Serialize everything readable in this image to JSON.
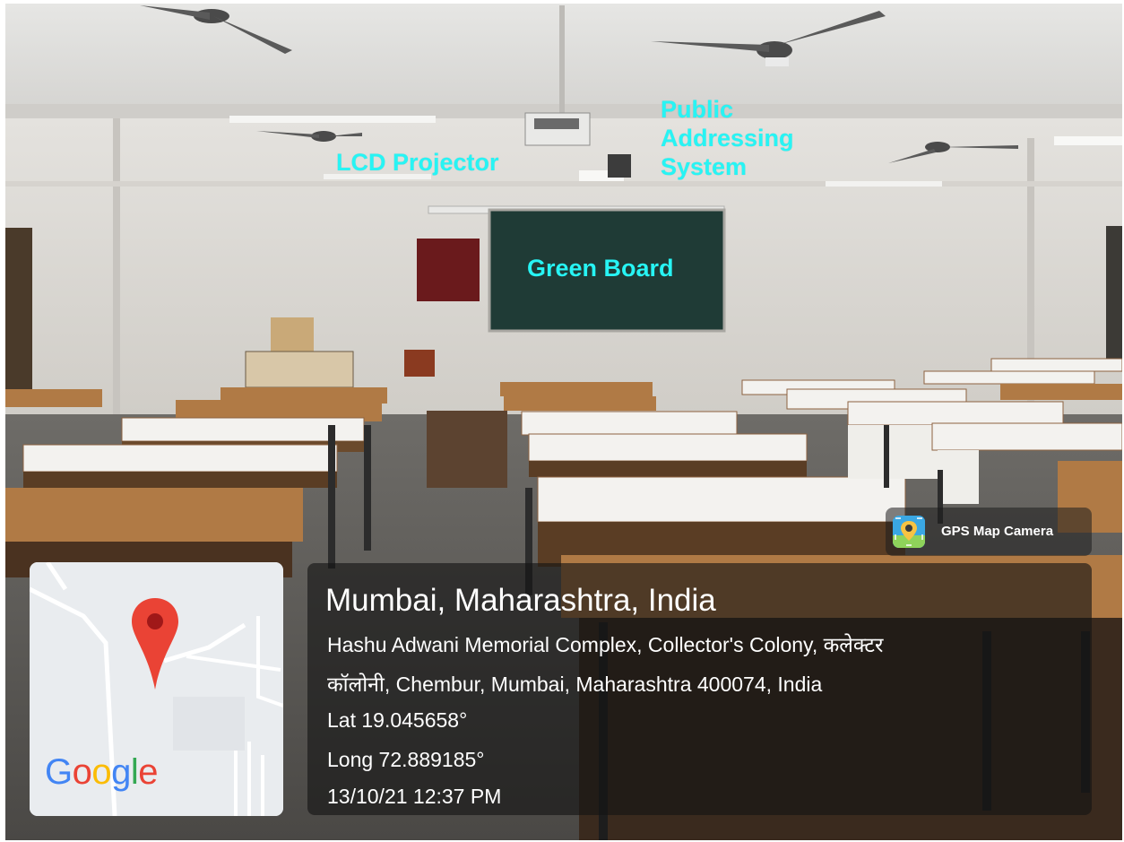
{
  "annotations": {
    "lcd_projector": "LCD Projector",
    "public_addressing_system": "Public Addressing System",
    "green_board": "Green Board"
  },
  "app_badge": {
    "name": "GPS Map Camera",
    "icon": "gps-map-camera-icon"
  },
  "map": {
    "logo_letters": [
      "G",
      "o",
      "o",
      "g",
      "l",
      "e"
    ],
    "logo_colors": [
      "#4285F4",
      "#EA4335",
      "#FBBC05",
      "#4285F4",
      "#34A853",
      "#EA4335"
    ],
    "pin_color": "#EA4335",
    "pin_icon": "map-pin-icon"
  },
  "location": {
    "title": "Mumbai, Maharashtra, India",
    "address_line1": "Hashu Adwani Memorial Complex, Collector's Colony, कलेक्टर",
    "address_line2": "कॉलोनी, Chembur, Mumbai, Maharashtra 400074, India",
    "latitude": "Lat 19.045658°",
    "longitude": "Long 72.889185°",
    "timestamp": "13/10/21 12:37 PM"
  },
  "colors": {
    "annotation_text": "#27f4f4",
    "board": "#1f3b36",
    "desk_top": "#f3f2ef",
    "desk_wood": "#b07a45"
  }
}
